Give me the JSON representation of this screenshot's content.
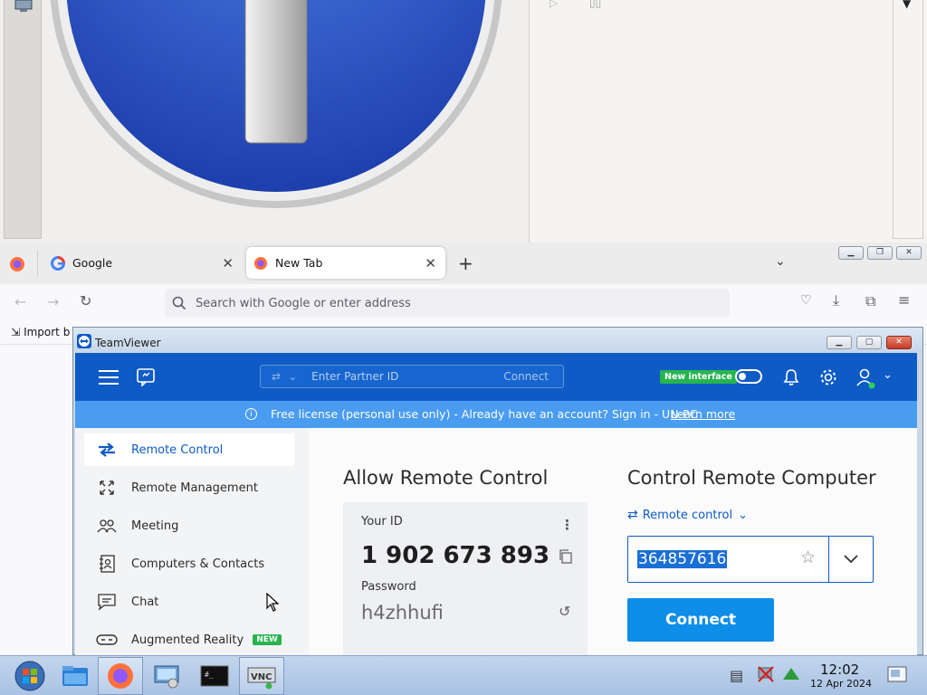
{
  "firefox": {
    "tabs": [
      {
        "label": "Google"
      },
      {
        "label": "New Tab"
      }
    ],
    "search_placeholder": "Search with Google or enter address",
    "bookmarks": {
      "import_label": "Import b"
    }
  },
  "teamviewer": {
    "window_title": "TeamViewer",
    "partner_id_placeholder": "Enter Partner ID",
    "header_connect": "Connect",
    "new_interface_label": "New interface",
    "banner_text": "Free license (personal use only) - Already have an account? Sign in - UN-PC",
    "banner_link": "Learn more",
    "nav": [
      {
        "label": "Remote Control",
        "icon": "arrows-swap-icon"
      },
      {
        "label": "Remote Management",
        "icon": "expand-arrows-icon"
      },
      {
        "label": "Meeting",
        "icon": "people-icon"
      },
      {
        "label": "Computers & Contacts",
        "icon": "contact-book-icon"
      },
      {
        "label": "Chat",
        "icon": "chat-icon"
      },
      {
        "label": "Augmented Reality",
        "icon": "ar-goggles-icon"
      }
    ],
    "nav_new_badge": "NEW",
    "allow": {
      "heading": "Allow Remote Control",
      "your_id_label": "Your ID",
      "your_id": "1 902 673 893",
      "password_label": "Password",
      "password": "h4zhhufi"
    },
    "control": {
      "heading": "Control Remote Computer",
      "mode": "Remote control",
      "partner_id_value": "364857616",
      "connect_button": "Connect"
    }
  },
  "taskbar": {
    "time": "12:02",
    "date": "12 Apr 2024"
  },
  "colors": {
    "tv_blue": "#0e5bc6",
    "tv_banner": "#4a9cf0",
    "tv_connect": "#0e8ee9",
    "new_badge": "#27b44f"
  }
}
